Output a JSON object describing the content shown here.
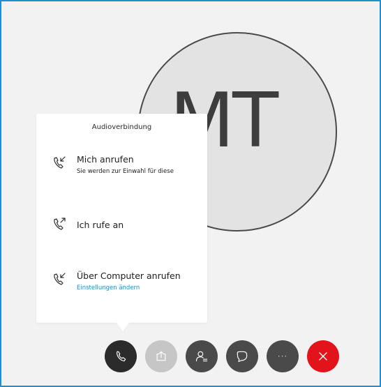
{
  "participant": {
    "initials": "MT"
  },
  "audio_panel": {
    "title": "Audioverbindung",
    "options": [
      {
        "label": "Mich anrufen",
        "sub": "Sie werden zur Einwahl für diese",
        "icon": "phone-incoming-icon"
      },
      {
        "label": "Ich rufe an",
        "icon": "phone-outgoing-icon"
      },
      {
        "label": "Über Computer anrufen",
        "link": "Einstellungen ändern",
        "icon": "phone-incoming-icon"
      }
    ]
  },
  "toolbar": {
    "buttons": [
      {
        "name": "audio-button",
        "icon": "phone-icon",
        "color": "#2b2b2b"
      },
      {
        "name": "share-button",
        "icon": "share-icon",
        "color": "#c6c6c6"
      },
      {
        "name": "participants-button",
        "icon": "participants-icon",
        "color": "#4a4a4a"
      },
      {
        "name": "chat-button",
        "icon": "chat-icon",
        "color": "#4a4a4a"
      },
      {
        "name": "more-button",
        "icon": "more-icon",
        "label": "···",
        "color": "#4a4a4a"
      },
      {
        "name": "leave-button",
        "icon": "close-icon",
        "color": "#e3131b"
      }
    ]
  },
  "colors": {
    "accent": "#1b8fd1",
    "frame": "#1f8fd4",
    "danger": "#e3131b"
  }
}
